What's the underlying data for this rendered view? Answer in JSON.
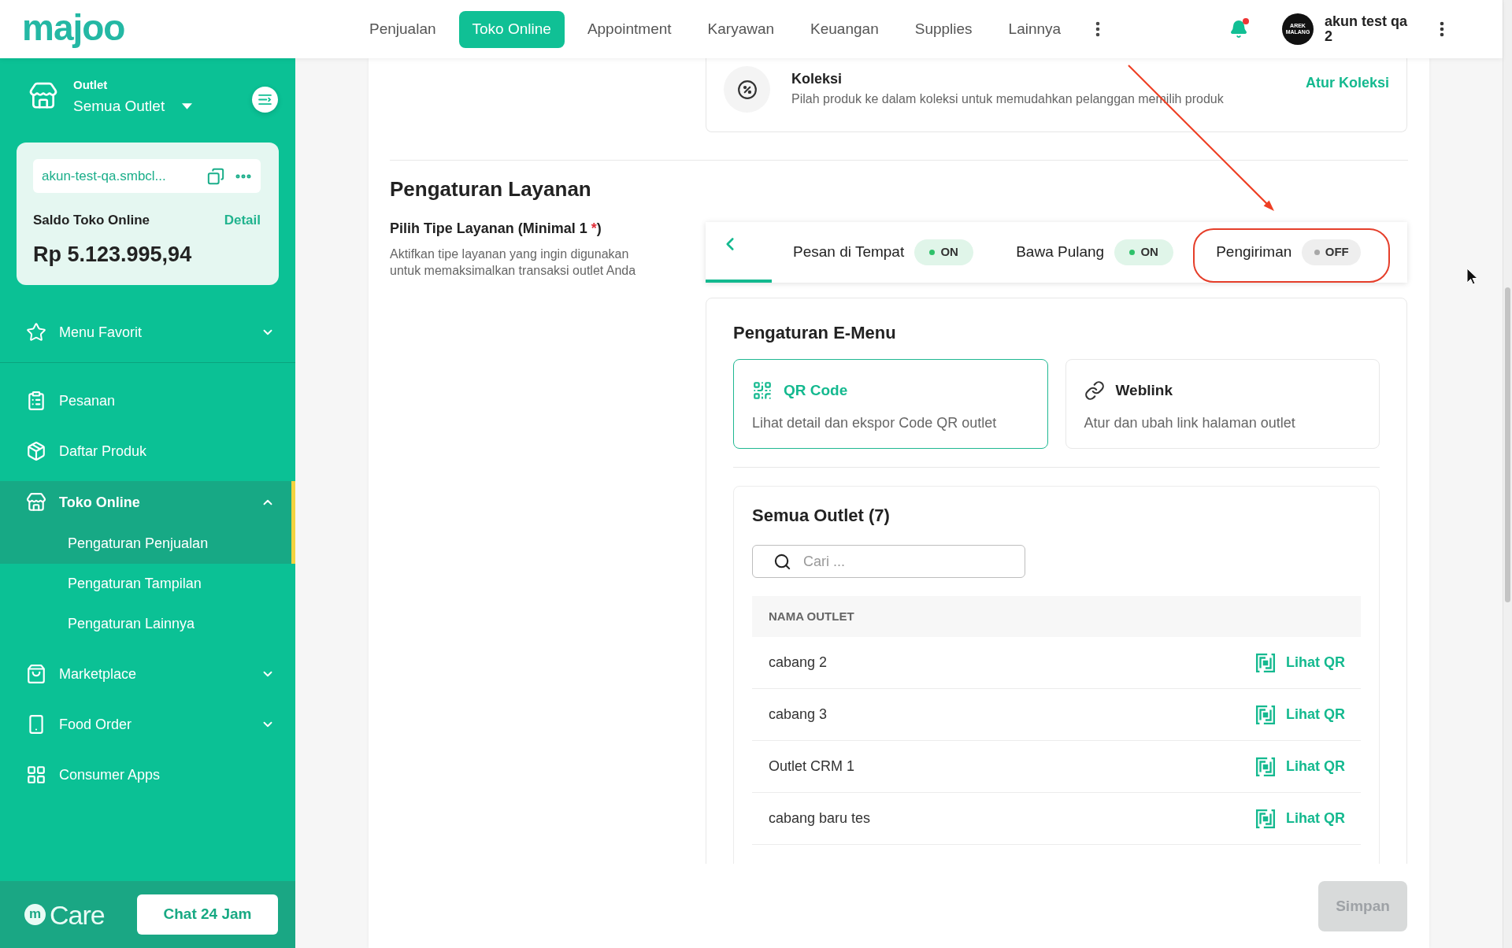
{
  "topbar": {
    "logo": "majoo",
    "nav": [
      {
        "label": "Penjualan",
        "selected": false
      },
      {
        "label": "Toko Online",
        "selected": true
      },
      {
        "label": "Appointment",
        "selected": false
      },
      {
        "label": "Karyawan",
        "selected": false
      },
      {
        "label": "Keuangan",
        "selected": false
      },
      {
        "label": "Supplies",
        "selected": false
      },
      {
        "label": "Lainnya",
        "selected": false
      }
    ],
    "notifications": {
      "unread": true
    },
    "user": {
      "avatar_text": "AREK MALANG",
      "name": "akun test qa 2"
    }
  },
  "sidebar": {
    "outlet_label": "Outlet",
    "outlet_value": "Semua Outlet",
    "store_url": "akun-test-qa.smbcl...",
    "balance_label": "Saldo Toko Online",
    "balance_link": "Detail",
    "balance": "Rp 5.123.995,94",
    "favorites": {
      "label": "Menu Favorit",
      "expanded": false
    },
    "items": [
      {
        "label": "Pesanan",
        "selected": false
      },
      {
        "label": "Daftar Produk",
        "selected": false
      },
      {
        "label": "Toko Online",
        "selected": true,
        "expanded": true,
        "children": [
          {
            "label": "Pengaturan Penjualan",
            "selected": true
          },
          {
            "label": "Pengaturan Tampilan",
            "selected": false
          },
          {
            "label": "Pengaturan Lainnya",
            "selected": false
          }
        ]
      },
      {
        "label": "Marketplace",
        "selected": false,
        "expanded": false
      },
      {
        "label": "Food Order",
        "selected": false,
        "expanded": false
      },
      {
        "label": "Consumer Apps",
        "selected": false
      }
    ],
    "care": {
      "mark": "m",
      "name": "Care"
    },
    "chat_button": "Chat 24 Jam"
  },
  "content": {
    "collection": {
      "title": "Koleksi",
      "description": "Pilah produk ke dalam koleksi untuk memudahkan pelanggan memilih produk",
      "action": "Atur Koleksi"
    },
    "service": {
      "title": "Pengaturan Layanan",
      "field_label": {
        "before": "Pilih Tipe Layanan (Minimal 1",
        "mark": "*",
        "after": ")"
      },
      "description": "Aktifkan tipe layanan yang ingin digunakan untuk memaksimalkan transaksi outlet Anda",
      "service_types": [
        {
          "label": "Pesan di Tempat",
          "on": true,
          "status": "ON"
        },
        {
          "label": "Bawa Pulang",
          "on": true,
          "status": "ON"
        },
        {
          "label": "Pengiriman",
          "on": false,
          "status": "OFF"
        }
      ]
    },
    "emenu": {
      "title": "Pengaturan E-Menu",
      "options": [
        {
          "title": "QR Code",
          "description": "Lihat detail dan ekspor Code QR outlet",
          "selected": true
        },
        {
          "title": "Weblink",
          "description": "Atur dan ubah link halaman outlet",
          "selected": false
        }
      ]
    },
    "outlets": {
      "title": "Semua Outlet (7)",
      "search": {
        "placeholder": "Cari ..."
      },
      "columns": [
        "NAMA OUTLET"
      ],
      "rows": [
        {
          "name": "cabang 2",
          "action": "Lihat QR"
        },
        {
          "name": "cabang 3",
          "action": "Lihat QR"
        },
        {
          "name": "Outlet CRM 1",
          "action": "Lihat QR"
        },
        {
          "name": "cabang baru tes",
          "action": "Lihat QR"
        }
      ]
    }
  },
  "save_button": {
    "label": "Simpan",
    "disabled": true
  },
  "annotations": {
    "arrow": true,
    "outline": true
  }
}
